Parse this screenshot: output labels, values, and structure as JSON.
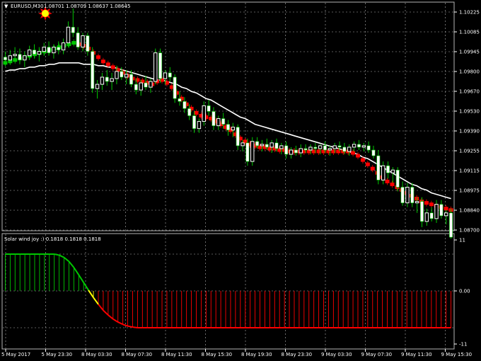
{
  "header": {
    "symbol_label": "EURUSD,M30",
    "ohlc": "1.08701 1.08709 1.08637 1.08645",
    "dropdown_glyph": "▼"
  },
  "indicator": {
    "title": "Solar wind joy :) 0.1818 0.1818 0.1818",
    "ticks": [
      "11",
      "0.00",
      "-11"
    ]
  },
  "price_axis": {
    "ticks": [
      "1.10225",
      "1.10085",
      "1.09945",
      "1.09800",
      "1.09670",
      "1.09530",
      "1.09390",
      "1.09255",
      "1.09115",
      "1.08975",
      "1.08840",
      "1.08700"
    ]
  },
  "time_axis": {
    "ticks": [
      "5 May 2017",
      "5 May 23:30",
      "8 May 03:30",
      "8 May 07:30",
      "8 May 11:30",
      "8 May 15:30",
      "8 May 19:30",
      "8 May 23:30",
      "9 May 03:30",
      "9 May 07:30",
      "9 May 11:30",
      "9 May 15:30"
    ]
  },
  "colors": {
    "background": "#000000",
    "grid": "#b4b4b4",
    "bull_candle": "#ffffff",
    "bear_candle": "#ffffff",
    "wick": "#00c800",
    "ma_line": "#ffffff",
    "trend_up": "#00c800",
    "trend_down": "#ff0000",
    "hist_up": "#00c800",
    "hist_down": "#ff0000",
    "hist_turn": "#ffff00",
    "star": "#ff0000",
    "star_center": "#ffff00"
  },
  "chart_data": {
    "type": "candlestick",
    "symbol": "EURUSD",
    "timeframe": "M30",
    "ylim": [
      1.087,
      1.1029
    ],
    "candles": [
      [
        1.0991,
        1.0995,
        1.0985,
        1.0989
      ],
      [
        1.0989,
        1.0996,
        1.0986,
        1.0992
      ],
      [
        1.0992,
        1.0998,
        1.0988,
        1.0993
      ],
      [
        1.0993,
        1.0997,
        1.0986,
        1.0989
      ],
      [
        1.0989,
        1.0995,
        1.0984,
        1.0992
      ],
      [
        1.0992,
        1.0999,
        1.0989,
        1.0996
      ],
      [
        1.0996,
        1.1,
        1.099,
        1.0993
      ],
      [
        1.0993,
        1.0998,
        1.0988,
        1.0995
      ],
      [
        1.0995,
        1.1001,
        1.0992,
        1.0998
      ],
      [
        1.0998,
        1.1002,
        1.0992,
        1.0994
      ],
      [
        1.0994,
        1.1,
        1.099,
        1.0998
      ],
      [
        1.0998,
        1.1002,
        1.0993,
        1.0996
      ],
      [
        1.0996,
        1.1004,
        1.0993,
        1.1001
      ],
      [
        1.1001,
        1.1016,
        1.0998,
        1.1012
      ],
      [
        1.1012,
        1.1025,
        1.1005,
        1.1008
      ],
      [
        1.1008,
        1.1012,
        1.0996,
        1.0998
      ],
      [
        1.0998,
        1.1008,
        1.0995,
        1.1006
      ],
      [
        1.1006,
        1.1008,
        1.0992,
        1.0995
      ],
      [
        1.0995,
        1.0998,
        1.0966,
        1.0969
      ],
      [
        1.0969,
        1.0975,
        1.0962,
        1.0972
      ],
      [
        1.0972,
        1.098,
        1.0968,
        1.0977
      ],
      [
        1.0977,
        1.0982,
        1.0971,
        1.0974
      ],
      [
        1.0974,
        1.098,
        1.0968,
        1.0976
      ],
      [
        1.0976,
        1.0985,
        1.0972,
        1.0981
      ],
      [
        1.0981,
        1.0984,
        1.0975,
        1.0977
      ],
      [
        1.0977,
        1.0982,
        1.0972,
        1.0979
      ],
      [
        1.0979,
        1.0982,
        1.097,
        1.0972
      ],
      [
        1.0972,
        1.0976,
        1.0965,
        1.0968
      ],
      [
        1.0968,
        1.0975,
        1.0964,
        1.0973
      ],
      [
        1.0973,
        1.0978,
        1.0968,
        1.097
      ],
      [
        1.097,
        1.0976,
        1.0966,
        1.0974
      ],
      [
        1.0974,
        1.0997,
        1.0972,
        1.0994
      ],
      [
        1.0994,
        1.0997,
        1.0973,
        1.0976
      ],
      [
        1.0976,
        1.0982,
        1.0972,
        1.098
      ],
      [
        1.098,
        1.0984,
        1.0974,
        1.0977
      ],
      [
        1.0977,
        1.0979,
        1.0959,
        1.0962
      ],
      [
        1.0962,
        1.0967,
        1.0957,
        1.096
      ],
      [
        1.096,
        1.0963,
        1.0952,
        1.0955
      ],
      [
        1.0955,
        1.0958,
        1.0947,
        1.095
      ],
      [
        1.095,
        1.0953,
        1.0938,
        1.0941
      ],
      [
        1.0941,
        1.0948,
        1.0938,
        1.0946
      ],
      [
        1.0946,
        1.096,
        1.0943,
        1.0957
      ],
      [
        1.0957,
        1.0961,
        1.095,
        1.0953
      ],
      [
        1.0953,
        1.0956,
        1.094,
        1.0943
      ],
      [
        1.0943,
        1.095,
        1.094,
        1.0948
      ],
      [
        1.0948,
        1.0952,
        1.0941,
        1.0944
      ],
      [
        1.0944,
        1.0947,
        1.0936,
        1.094
      ],
      [
        1.094,
        1.0945,
        1.0935,
        1.0942
      ],
      [
        1.0942,
        1.0944,
        1.0926,
        1.0929
      ],
      [
        1.0929,
        1.0933,
        1.0925,
        1.0931
      ],
      [
        1.0931,
        1.0934,
        1.0915,
        1.0918
      ],
      [
        1.0918,
        1.0935,
        1.0915,
        1.0932
      ],
      [
        1.0932,
        1.0935,
        1.0927,
        1.0929
      ],
      [
        1.0929,
        1.0933,
        1.0925,
        1.093
      ],
      [
        1.093,
        1.0934,
        1.0926,
        1.0928
      ],
      [
        1.0928,
        1.0933,
        1.0924,
        1.0931
      ],
      [
        1.0931,
        1.0934,
        1.0925,
        1.0927
      ],
      [
        1.0927,
        1.0931,
        1.0923,
        1.0929
      ],
      [
        1.0929,
        1.0932,
        1.092,
        1.0923
      ],
      [
        1.0923,
        1.0928,
        1.092,
        1.0926
      ],
      [
        1.0926,
        1.0929,
        1.0922,
        1.0924
      ],
      [
        1.0924,
        1.093,
        1.0921,
        1.0927
      ],
      [
        1.0927,
        1.093,
        1.0924,
        1.0926
      ],
      [
        1.0926,
        1.093,
        1.0923,
        1.0928
      ],
      [
        1.0928,
        1.0931,
        1.0924,
        1.0927
      ],
      [
        1.0927,
        1.093,
        1.0923,
        1.0929
      ],
      [
        1.0929,
        1.0932,
        1.0924,
        1.0926
      ],
      [
        1.0926,
        1.0929,
        1.0922,
        1.0927
      ],
      [
        1.0927,
        1.0931,
        1.0924,
        1.0929
      ],
      [
        1.0929,
        1.0932,
        1.0925,
        1.0928
      ],
      [
        1.0928,
        1.0931,
        1.0923,
        1.0925
      ],
      [
        1.0925,
        1.093,
        1.0922,
        1.0928
      ],
      [
        1.0928,
        1.0932,
        1.0925,
        1.093
      ],
      [
        1.093,
        1.0933,
        1.0926,
        1.0928
      ],
      [
        1.0928,
        1.0931,
        1.0925,
        1.0929
      ],
      [
        1.0929,
        1.0932,
        1.0924,
        1.0926
      ],
      [
        1.0926,
        1.0929,
        1.092,
        1.0922
      ],
      [
        1.0922,
        1.0926,
        1.0902,
        1.0905
      ],
      [
        1.0905,
        1.0918,
        1.0902,
        1.0915
      ],
      [
        1.0915,
        1.0918,
        1.0906,
        1.091
      ],
      [
        1.091,
        1.0914,
        1.0903,
        1.0912
      ],
      [
        1.0912,
        1.0914,
        1.0897,
        1.09
      ],
      [
        1.09,
        1.0904,
        1.0887,
        1.0889
      ],
      [
        1.0889,
        1.0903,
        1.0886,
        1.09
      ],
      [
        1.09,
        1.0903,
        1.0886,
        1.0889
      ],
      [
        1.0889,
        1.0893,
        1.0882,
        1.089
      ],
      [
        1.089,
        1.0893,
        1.0872,
        1.0876
      ],
      [
        1.0876,
        1.0885,
        1.0873,
        1.0882
      ],
      [
        1.0882,
        1.0886,
        1.0876,
        1.0878
      ],
      [
        1.0878,
        1.0891,
        1.0875,
        1.0888
      ],
      [
        1.0888,
        1.0891,
        1.0878,
        1.088
      ],
      [
        1.088,
        1.0884,
        1.0874,
        1.0882
      ],
      [
        1.0882,
        1.0885,
        1.0864,
        1.0865
      ]
    ],
    "moving_average": [
      1.0981,
      1.0982,
      1.0982,
      1.0983,
      1.0983,
      1.0984,
      1.0984,
      1.0985,
      1.0985,
      1.0986,
      1.0986,
      1.0987,
      1.0987,
      1.0987,
      1.0987,
      1.0987,
      1.0986,
      1.0986,
      1.0986,
      1.0985,
      1.0985,
      1.0984,
      1.0984,
      1.0983,
      1.0982,
      1.0981,
      1.098,
      1.0979,
      1.0978,
      1.0977,
      1.0976,
      1.0975,
      1.0975,
      1.0974,
      1.0973,
      1.0972,
      1.097,
      1.0969,
      1.0967,
      1.0966,
      1.0964,
      1.0962,
      1.0961,
      1.0959,
      1.0957,
      1.0955,
      1.0953,
      1.0951,
      1.0949,
      1.0948,
      1.0946,
      1.0944,
      1.0943,
      1.0942,
      1.0941,
      1.094,
      1.0939,
      1.0938,
      1.0937,
      1.0936,
      1.0935,
      1.0934,
      1.0933,
      1.0932,
      1.0931,
      1.093,
      1.0929,
      1.0928,
      1.0927,
      1.0926,
      1.0925,
      1.0924,
      1.0923,
      1.0921,
      1.092,
      1.0918,
      1.0916,
      1.0914,
      1.0912,
      1.091,
      1.0908,
      1.0906,
      1.0904,
      1.0902,
      1.0901,
      1.0899,
      1.0898,
      1.0896,
      1.0895,
      1.0894,
      1.0893,
      1.0892
    ],
    "trend_line": [
      1.0987,
      1.0988,
      1.0989,
      1.099,
      1.0991,
      1.0992,
      1.0993,
      1.0994,
      1.0995,
      1.0996,
      1.0997,
      1.0998,
      1.0999,
      1.1,
      1.1001,
      1.1,
      1.0999,
      1.0997,
      1.0994,
      1.0991,
      1.0988,
      1.0986,
      1.0984,
      1.0982,
      1.098,
      1.0978,
      1.0976,
      1.0975,
      1.0974,
      1.0973,
      1.0972,
      1.0974,
      1.0975,
      1.0973,
      1.097,
      1.0966,
      1.0962,
      1.0958,
      1.0955,
      1.0952,
      1.095,
      1.0949,
      1.0948,
      1.0946,
      1.0944,
      1.0942,
      1.094,
      1.0937,
      1.0934,
      1.0932,
      1.093,
      1.0929,
      1.0928,
      1.0928,
      1.0927,
      1.0927,
      1.0926,
      1.0926,
      1.0925,
      1.0925,
      1.0925,
      1.0925,
      1.0925,
      1.0925,
      1.0925,
      1.0925,
      1.0925,
      1.0925,
      1.0925,
      1.0925,
      1.0925,
      1.0924,
      1.0922,
      1.0919,
      1.0916,
      1.0913,
      1.091,
      1.0907,
      1.0904,
      1.0902,
      1.09,
      1.0898,
      1.0896,
      1.0894,
      1.0892,
      1.089,
      1.0889,
      1.0888,
      1.0887,
      1.0886,
      1.0885,
      1.0884
    ],
    "trend_turn_index": 15,
    "indicator_values": [
      11,
      11,
      11,
      11,
      11,
      11,
      11,
      11,
      11,
      11,
      11,
      10.7,
      10,
      8.8,
      7,
      4.8,
      2.5,
      0.2,
      -2,
      -4,
      -5.8,
      -7.2,
      -8.4,
      -9.3,
      -10,
      -10.5,
      -10.8,
      -11,
      -11,
      -11,
      -11,
      -11,
      -11,
      -11,
      -11,
      -11,
      -11,
      -11,
      -11,
      -11,
      -11,
      -11,
      -11,
      -11,
      -11,
      -11,
      -11,
      -11,
      -11,
      -11,
      -11,
      -11,
      -11,
      -11,
      -11,
      -11,
      -11,
      -11,
      -11,
      -11,
      -11,
      -11,
      -11,
      -11,
      -11,
      -11,
      -11,
      -11,
      -11,
      -11,
      -11,
      -11,
      -11,
      -11,
      -11,
      -11,
      -11,
      -11,
      -11,
      -11,
      -11,
      -11,
      -11,
      -11,
      -11,
      -11,
      -11,
      -11,
      -11,
      -11,
      -11,
      -11
    ],
    "indicator_ylim": [
      -11,
      11
    ]
  }
}
